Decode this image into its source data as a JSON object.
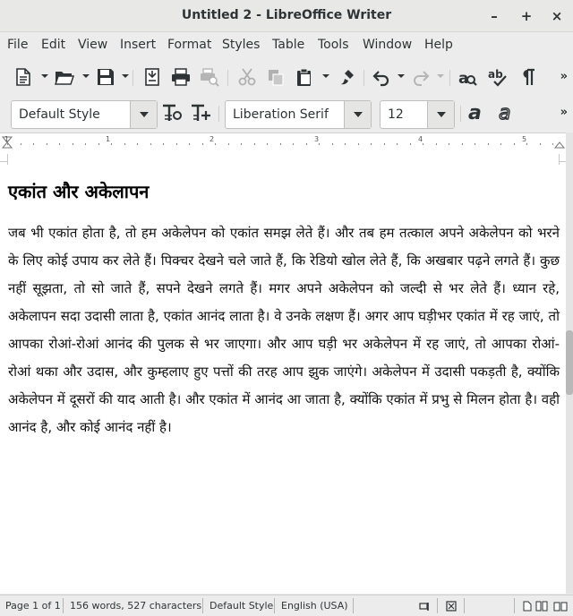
{
  "window": {
    "title": "Untitled 2 - LibreOffice Writer",
    "controls": {
      "minimize": "–",
      "maximize": "+",
      "close": "×"
    }
  },
  "menubar": [
    "File",
    "Edit",
    "View",
    "Insert",
    "Format",
    "Styles",
    "Table",
    "Tools",
    "Window",
    "Help"
  ],
  "toolbar": {
    "paragraph_style": "Default Style",
    "font_name": "Liberation Serif",
    "font_size": "12",
    "overflow": "»"
  },
  "ruler": {
    "labels": [
      "1",
      "1",
      "2",
      "3",
      "4",
      "5"
    ]
  },
  "document": {
    "heading": "एकांत और अकेलापन",
    "body": "जब भी एकांत होता है, तो हम अकेलेपन को एकांत समझ लेते हैं। और तब हम तत्काल अपने अकेलेपन को भरने के लिए कोई उपाय कर लेते हैं। पिक्चर देखने चले जाते हैं, कि रेडियो खोल लेते हैं, कि अखबार पढ़ने लगते हैं। कुछ नहीं सूझता, तो सो जाते हैं, सपने देखने लगते हैं। मगर अपने अकेलेपन को जल्दी से भर लेते हैं। ध्यान रहे, अकेलापन सदा उदासी लाता है, एकांत आनंद लाता है। वे उनके लक्षण हैं। अगर आप घड़ीभर एकांत में रह जाएं, तो आपका रोआं-रोआं आनंद की पुलक से भर जाएगा। और आप घड़ी भर अकेलेपन में रह जाएं, तो आपका रोआं-रोआं थका और उदास, और कुम्हलाए हुए पत्तों की तरह आप झुक जाएंगे। अकेलेपन में उदासी पकड़ती है, क्योंकि अकेलेपन में दूसरों की याद आती है। और एकांत में आनंद आ जाता है, क्योंकि एकांत में प्रभु से मिलन होता है। वही आनंद है, और कोई आनंद नहीं है।"
  },
  "statusbar": {
    "page": "Page 1 of 1",
    "words": "156 words, 527 characters",
    "style": "Default Style",
    "language": "English (USA)"
  }
}
